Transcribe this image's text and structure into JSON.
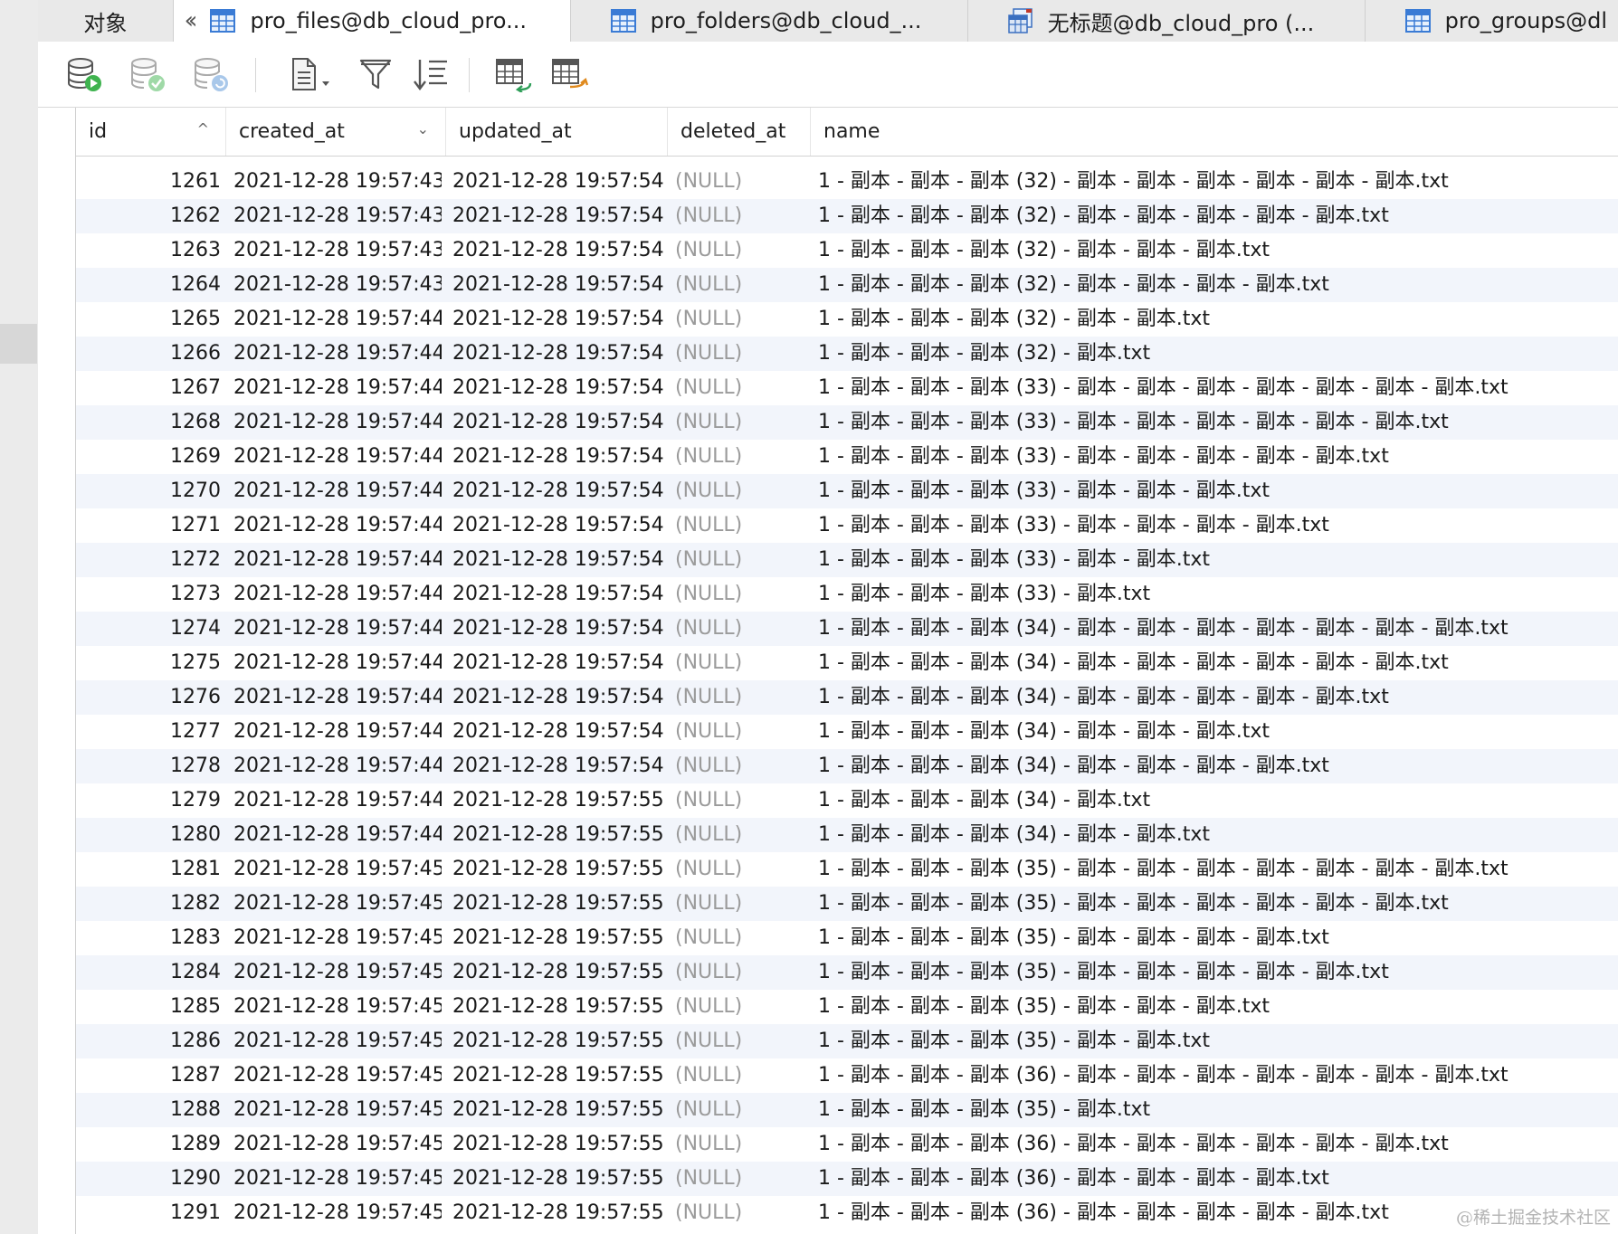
{
  "tabs": [
    {
      "label": "对象"
    },
    {
      "label": "pro_files@db_cloud_pro..."
    },
    {
      "label": "pro_folders@db_cloud_..."
    },
    {
      "label": "无标题@db_cloud_pro (..."
    },
    {
      "label": "pro_groups@dl"
    }
  ],
  "toolbar": {
    "icons": [
      "db-run-icon",
      "db-check-icon",
      "db-refresh-icon",
      "document-menu-icon",
      "filter-icon",
      "sort-icon",
      "import-table-icon",
      "export-table-icon"
    ]
  },
  "columns": {
    "id": "id",
    "created_at": "created_at",
    "updated_at": "updated_at",
    "deleted_at": "deleted_at",
    "name": "name"
  },
  "rows": [
    {
      "id": "1261",
      "created_at": "2021-12-28 19:57:43",
      "updated_at": "2021-12-28 19:57:54",
      "deleted_at": "(NULL)",
      "name": "1 - 副本 - 副本 - 副本 (32) - 副本 - 副本 - 副本 - 副本 - 副本 - 副本.txt"
    },
    {
      "id": "1262",
      "created_at": "2021-12-28 19:57:43",
      "updated_at": "2021-12-28 19:57:54",
      "deleted_at": "(NULL)",
      "name": "1 - 副本 - 副本 - 副本 (32) - 副本 - 副本 - 副本 - 副本 - 副本.txt"
    },
    {
      "id": "1263",
      "created_at": "2021-12-28 19:57:43",
      "updated_at": "2021-12-28 19:57:54",
      "deleted_at": "(NULL)",
      "name": "1 - 副本 - 副本 - 副本 (32) - 副本 - 副本 - 副本.txt"
    },
    {
      "id": "1264",
      "created_at": "2021-12-28 19:57:43",
      "updated_at": "2021-12-28 19:57:54",
      "deleted_at": "(NULL)",
      "name": "1 - 副本 - 副本 - 副本 (32) - 副本 - 副本 - 副本 - 副本.txt"
    },
    {
      "id": "1265",
      "created_at": "2021-12-28 19:57:44",
      "updated_at": "2021-12-28 19:57:54",
      "deleted_at": "(NULL)",
      "name": "1 - 副本 - 副本 - 副本 (32) - 副本 - 副本.txt"
    },
    {
      "id": "1266",
      "created_at": "2021-12-28 19:57:44",
      "updated_at": "2021-12-28 19:57:54",
      "deleted_at": "(NULL)",
      "name": "1 - 副本 - 副本 - 副本 (32) - 副本.txt"
    },
    {
      "id": "1267",
      "created_at": "2021-12-28 19:57:44",
      "updated_at": "2021-12-28 19:57:54",
      "deleted_at": "(NULL)",
      "name": "1 - 副本 - 副本 - 副本 (33) - 副本 - 副本 - 副本 - 副本 - 副本 - 副本 - 副本.txt"
    },
    {
      "id": "1268",
      "created_at": "2021-12-28 19:57:44",
      "updated_at": "2021-12-28 19:57:54",
      "deleted_at": "(NULL)",
      "name": "1 - 副本 - 副本 - 副本 (33) - 副本 - 副本 - 副本 - 副本 - 副本 - 副本.txt"
    },
    {
      "id": "1269",
      "created_at": "2021-12-28 19:57:44",
      "updated_at": "2021-12-28 19:57:54",
      "deleted_at": "(NULL)",
      "name": "1 - 副本 - 副本 - 副本 (33) - 副本 - 副本 - 副本 - 副本 - 副本.txt"
    },
    {
      "id": "1270",
      "created_at": "2021-12-28 19:57:44",
      "updated_at": "2021-12-28 19:57:54",
      "deleted_at": "(NULL)",
      "name": "1 - 副本 - 副本 - 副本 (33) - 副本 - 副本 - 副本.txt"
    },
    {
      "id": "1271",
      "created_at": "2021-12-28 19:57:44",
      "updated_at": "2021-12-28 19:57:54",
      "deleted_at": "(NULL)",
      "name": "1 - 副本 - 副本 - 副本 (33) - 副本 - 副本 - 副本 - 副本.txt"
    },
    {
      "id": "1272",
      "created_at": "2021-12-28 19:57:44",
      "updated_at": "2021-12-28 19:57:54",
      "deleted_at": "(NULL)",
      "name": "1 - 副本 - 副本 - 副本 (33) - 副本 - 副本.txt"
    },
    {
      "id": "1273",
      "created_at": "2021-12-28 19:57:44",
      "updated_at": "2021-12-28 19:57:54",
      "deleted_at": "(NULL)",
      "name": "1 - 副本 - 副本 - 副本 (33) - 副本.txt"
    },
    {
      "id": "1274",
      "created_at": "2021-12-28 19:57:44",
      "updated_at": "2021-12-28 19:57:54",
      "deleted_at": "(NULL)",
      "name": "1 - 副本 - 副本 - 副本 (34) - 副本 - 副本 - 副本 - 副本 - 副本 - 副本 - 副本.txt"
    },
    {
      "id": "1275",
      "created_at": "2021-12-28 19:57:44",
      "updated_at": "2021-12-28 19:57:54",
      "deleted_at": "(NULL)",
      "name": "1 - 副本 - 副本 - 副本 (34) - 副本 - 副本 - 副本 - 副本 - 副本 - 副本.txt"
    },
    {
      "id": "1276",
      "created_at": "2021-12-28 19:57:44",
      "updated_at": "2021-12-28 19:57:54",
      "deleted_at": "(NULL)",
      "name": "1 - 副本 - 副本 - 副本 (34) - 副本 - 副本 - 副本 - 副本 - 副本.txt"
    },
    {
      "id": "1277",
      "created_at": "2021-12-28 19:57:44",
      "updated_at": "2021-12-28 19:57:54",
      "deleted_at": "(NULL)",
      "name": "1 - 副本 - 副本 - 副本 (34) - 副本 - 副本 - 副本.txt"
    },
    {
      "id": "1278",
      "created_at": "2021-12-28 19:57:44",
      "updated_at": "2021-12-28 19:57:54",
      "deleted_at": "(NULL)",
      "name": "1 - 副本 - 副本 - 副本 (34) - 副本 - 副本 - 副本 - 副本.txt"
    },
    {
      "id": "1279",
      "created_at": "2021-12-28 19:57:44",
      "updated_at": "2021-12-28 19:57:55",
      "deleted_at": "(NULL)",
      "name": "1 - 副本 - 副本 - 副本 (34) - 副本.txt"
    },
    {
      "id": "1280",
      "created_at": "2021-12-28 19:57:44",
      "updated_at": "2021-12-28 19:57:55",
      "deleted_at": "(NULL)",
      "name": "1 - 副本 - 副本 - 副本 (34) - 副本 - 副本.txt"
    },
    {
      "id": "1281",
      "created_at": "2021-12-28 19:57:45",
      "updated_at": "2021-12-28 19:57:55",
      "deleted_at": "(NULL)",
      "name": "1 - 副本 - 副本 - 副本 (35) - 副本 - 副本 - 副本 - 副本 - 副本 - 副本 - 副本.txt"
    },
    {
      "id": "1282",
      "created_at": "2021-12-28 19:57:45",
      "updated_at": "2021-12-28 19:57:55",
      "deleted_at": "(NULL)",
      "name": "1 - 副本 - 副本 - 副本 (35) - 副本 - 副本 - 副本 - 副本 - 副本 - 副本.txt"
    },
    {
      "id": "1283",
      "created_at": "2021-12-28 19:57:45",
      "updated_at": "2021-12-28 19:57:55",
      "deleted_at": "(NULL)",
      "name": "1 - 副本 - 副本 - 副本 (35) - 副本 - 副本 - 副本 - 副本.txt"
    },
    {
      "id": "1284",
      "created_at": "2021-12-28 19:57:45",
      "updated_at": "2021-12-28 19:57:55",
      "deleted_at": "(NULL)",
      "name": "1 - 副本 - 副本 - 副本 (35) - 副本 - 副本 - 副本 - 副本 - 副本.txt"
    },
    {
      "id": "1285",
      "created_at": "2021-12-28 19:57:45",
      "updated_at": "2021-12-28 19:57:55",
      "deleted_at": "(NULL)",
      "name": "1 - 副本 - 副本 - 副本 (35) - 副本 - 副本 - 副本.txt"
    },
    {
      "id": "1286",
      "created_at": "2021-12-28 19:57:45",
      "updated_at": "2021-12-28 19:57:55",
      "deleted_at": "(NULL)",
      "name": "1 - 副本 - 副本 - 副本 (35) - 副本 - 副本.txt"
    },
    {
      "id": "1287",
      "created_at": "2021-12-28 19:57:45",
      "updated_at": "2021-12-28 19:57:55",
      "deleted_at": "(NULL)",
      "name": "1 - 副本 - 副本 - 副本 (36) - 副本 - 副本 - 副本 - 副本 - 副本 - 副本 - 副本.txt"
    },
    {
      "id": "1288",
      "created_at": "2021-12-28 19:57:45",
      "updated_at": "2021-12-28 19:57:55",
      "deleted_at": "(NULL)",
      "name": "1 - 副本 - 副本 - 副本 (35) - 副本.txt"
    },
    {
      "id": "1289",
      "created_at": "2021-12-28 19:57:45",
      "updated_at": "2021-12-28 19:57:55",
      "deleted_at": "(NULL)",
      "name": "1 - 副本 - 副本 - 副本 (36) - 副本 - 副本 - 副本 - 副本 - 副本 - 副本.txt"
    },
    {
      "id": "1290",
      "created_at": "2021-12-28 19:57:45",
      "updated_at": "2021-12-28 19:57:55",
      "deleted_at": "(NULL)",
      "name": "1 - 副本 - 副本 - 副本 (36) - 副本 - 副本 - 副本 - 副本.txt"
    },
    {
      "id": "1291",
      "created_at": "2021-12-28 19:57:45",
      "updated_at": "2021-12-28 19:57:55",
      "deleted_at": "(NULL)",
      "name": "1 - 副本 - 副本 - 副本 (36) - 副本 - 副本 - 副本 - 副本 - 副本.txt"
    }
  ],
  "watermark": "@稀土掘金技术社区",
  "colors": {
    "alt_row": "#f2f5fb",
    "null_text": "#9b9b9b",
    "tab_bar": "#e9e9e9"
  }
}
